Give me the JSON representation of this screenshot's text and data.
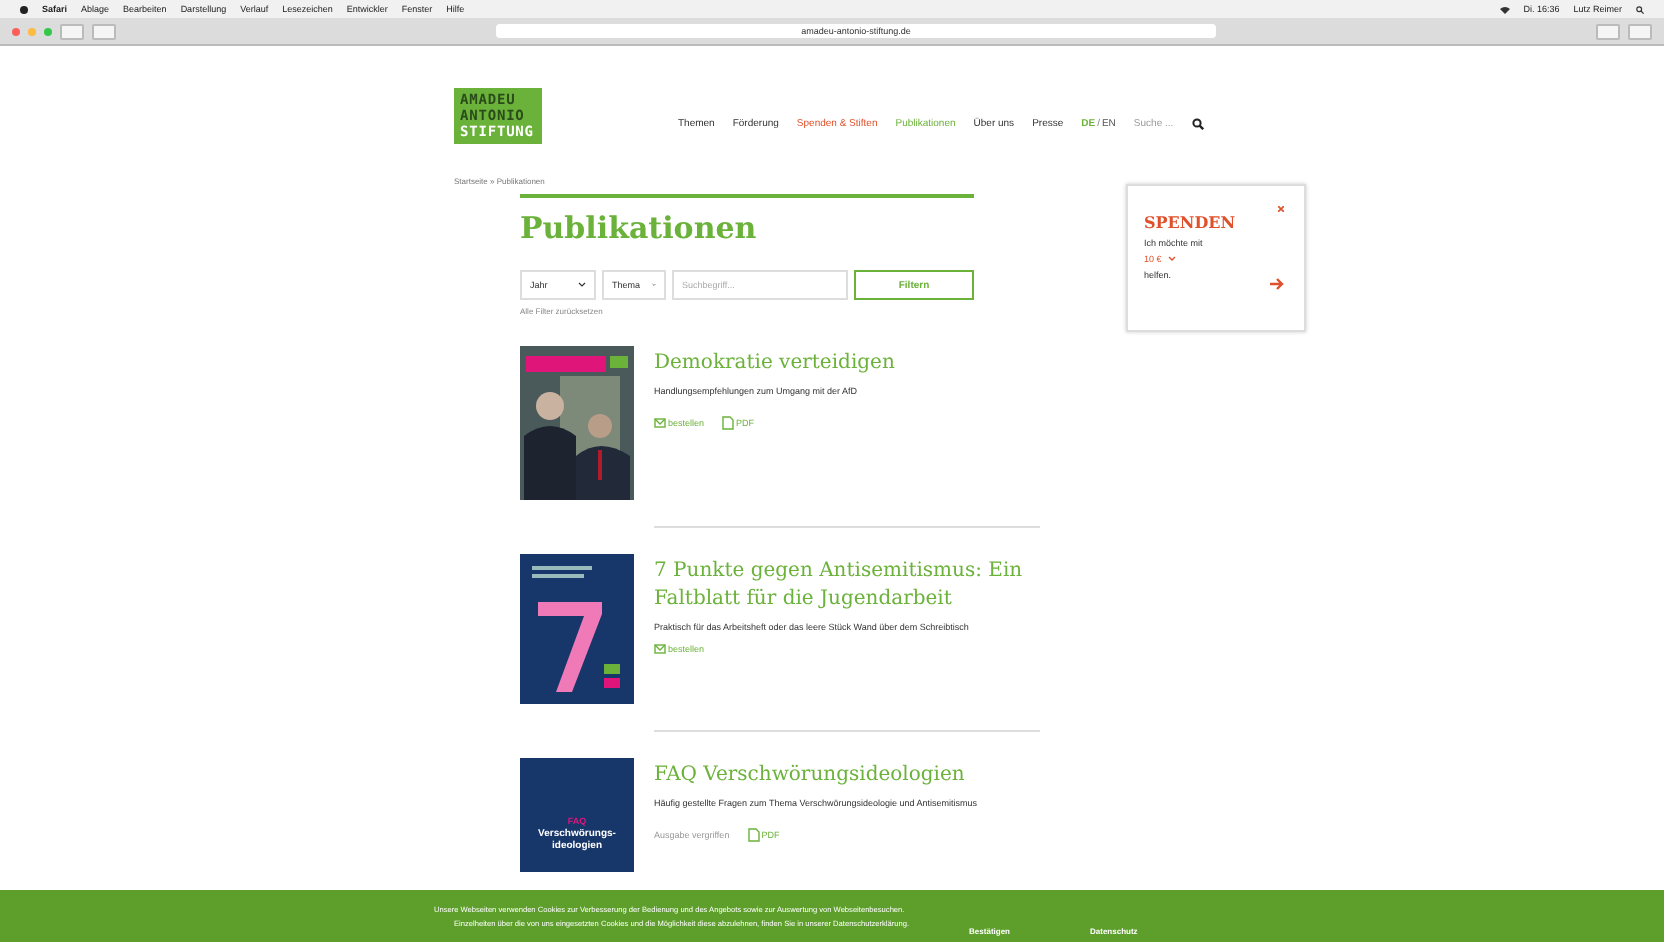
{
  "menu_bar": {
    "app": "Safari",
    "items": [
      "Ablage",
      "Bearbeiten",
      "Darstellung",
      "Verlauf",
      "Lesezeichen",
      "Entwickler",
      "Fenster",
      "Hilfe"
    ],
    "clock": "Di. 16:36",
    "user": "Lutz Reimer"
  },
  "browser": {
    "url": "amadeu-antonio-stiftung.de"
  },
  "logo": [
    "AMADEU",
    "ANTONIO",
    "STIFTUNG"
  ],
  "nav": [
    {
      "label": "Themen",
      "kind": "plain"
    },
    {
      "label": "Förderung",
      "kind": "plain"
    },
    {
      "label": "Spenden & Stiften",
      "kind": "donate"
    },
    {
      "label": "Publikationen",
      "kind": "current"
    },
    {
      "label": "Über uns",
      "kind": "plain"
    },
    {
      "label": "Presse",
      "kind": "plain"
    }
  ],
  "language_separator": "/",
  "languages": [
    {
      "label": "DE",
      "selected": true
    },
    {
      "label": "EN",
      "selected": false
    }
  ],
  "search": {
    "placeholder": "Suche ..."
  },
  "breadcrumb": "Startseite » Publikationen",
  "title": "Publikationen",
  "filters": {
    "year": "Jahr",
    "topic": "Thema",
    "placeholder": "Suchbegriff...",
    "button": "Filtern",
    "reset": "Alle Filter zurücksetzen"
  },
  "donate": {
    "title": "SPENDEN",
    "line1": "Ich möchte mit",
    "amount": "10 €",
    "line2": "helfen."
  },
  "publications": [
    {
      "title": "Demokratie verteidigen",
      "subtitle": "Handlungsempfehlungen zum Umgang mit der AfD",
      "order": "bestellen",
      "pdf": "PDF"
    },
    {
      "title": "7 Punkte gegen Antisemitismus: Ein Faltblatt für die Jugendarbeit",
      "subtitle": "Praktisch für das Arbeitsheft oder das leere Stück Wand über dem Schreibtisch",
      "kind": "seven",
      "order": "bestellen"
    },
    {
      "title": "FAQ Verschwörungsideologien",
      "subtitle": "Häufig gestellte Fragen zum Thema Verschwörungsideologie und Antisemitismus",
      "kind": "faq",
      "cover_text": [
        "FAQ",
        "Verschwörungs-",
        "ideologien"
      ],
      "unavailable": "Ausgabe vergriffen",
      "pdf": "PDF"
    }
  ],
  "cookie": {
    "text": [
      "Unsere Webseiten verwenden Cookies zur Verbesserung der Bedienung und des Angebots sowie zur Auswertung von Webseitenbesuchen.",
      "Einzelheiten über die von uns eingesetzten Cookies und die Möglichkeit diese abzulehnen, finden Sie in unserer Datenschutzerklärung."
    ],
    "buttons": [
      "Bestätigen",
      "Datenschutz"
    ]
  }
}
